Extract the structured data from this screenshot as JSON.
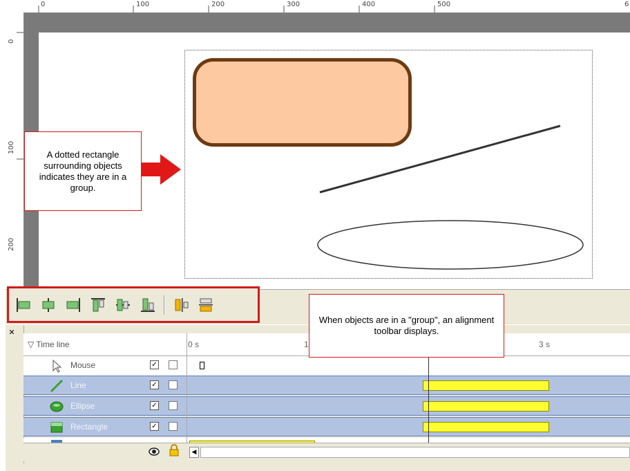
{
  "ruler": {
    "horizontal_labels": [
      "0",
      "100",
      "200",
      "300",
      "400",
      "500",
      "6"
    ],
    "vertical_labels": [
      "0",
      "100",
      "200"
    ]
  },
  "callouts": {
    "group_text": "A dotted rectangle surrounding objects indicates they are in a group.",
    "toolbar_text": "When objects are in a \"group\", an alignment toolbar displays."
  },
  "toolbar": {
    "buttons": [
      "align-left-icon",
      "align-center-icon",
      "align-right-icon",
      "align-top-icon",
      "align-middle-icon",
      "align-bottom-icon",
      "distribute-horizontal-icon",
      "distribute-vertical-icon"
    ]
  },
  "timeline": {
    "header_label": "Time line",
    "time_labels": [
      "0 s",
      "1",
      "3 s"
    ],
    "rows": [
      {
        "name": "Mouse",
        "visible": true,
        "locked": false,
        "selected": false
      },
      {
        "name": "Line",
        "visible": true,
        "locked": false,
        "selected": true
      },
      {
        "name": "Ellipse",
        "visible": true,
        "locked": false,
        "selected": true
      },
      {
        "name": "Rectangle",
        "visible": true,
        "locked": false,
        "selected": true
      }
    ]
  },
  "colors": {
    "callout_border": "#d21a1a",
    "arrow": "#e01818",
    "shape_fill": "#fdc9a0",
    "shape_stroke": "#6e3a12",
    "timeline_selected": "#b2c3e1",
    "timeline_bar": "#ffff32"
  }
}
